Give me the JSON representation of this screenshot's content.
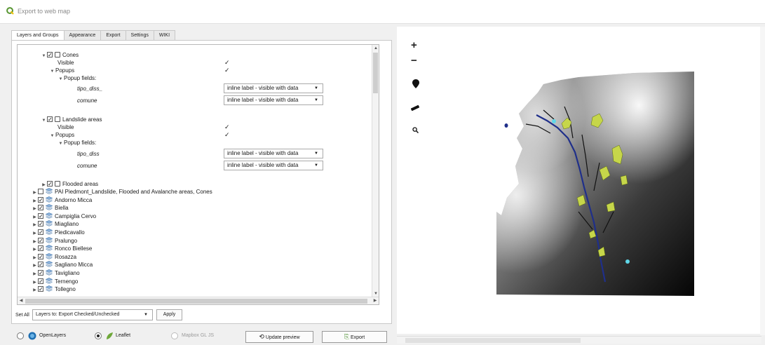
{
  "window": {
    "title": "Export to web map"
  },
  "tabs": [
    "Layers and Groups",
    "Appearance",
    "Export",
    "Settings",
    "WIKI"
  ],
  "tree": {
    "cones": {
      "name": "Cones",
      "visible": "Visible",
      "popups": "Popups",
      "popup_fields": "Popup fields:",
      "fields": [
        {
          "name": "tipo_diss_",
          "value": "inline label - visible with data"
        },
        {
          "name": "comune",
          "value": "inline label - visible with data"
        }
      ]
    },
    "landslide": {
      "name": "Landslide areas",
      "visible": "Visible",
      "popups": "Popups",
      "popup_fields": "Popup fields:",
      "fields": [
        {
          "name": "tipo_diss",
          "value": "inline label - visible with data"
        },
        {
          "name": "comune",
          "value": "inline label - visible with data"
        }
      ]
    },
    "flooded": "Flooded areas",
    "groups": [
      {
        "name": "PAI Piedmont_Landslide, Flooded and Avalanche areas, Cones",
        "checked": false
      },
      {
        "name": "Andorno Micca",
        "checked": true
      },
      {
        "name": "Biella",
        "checked": true
      },
      {
        "name": "Campiglia Cervo",
        "checked": true
      },
      {
        "name": "Miagliano",
        "checked": true
      },
      {
        "name": "Piedicavallo",
        "checked": true
      },
      {
        "name": "Pralungo",
        "checked": true
      },
      {
        "name": "Ronco Biellese",
        "checked": true
      },
      {
        "name": "Rosazza",
        "checked": true
      },
      {
        "name": "Sagliano Micca",
        "checked": true
      },
      {
        "name": "Tavigliano",
        "checked": true
      },
      {
        "name": "Ternengo",
        "checked": true
      },
      {
        "name": "Tollegno",
        "checked": true
      }
    ]
  },
  "set_all": {
    "label": "Set All",
    "value": "Layers to: Export Checked/Unchecked",
    "apply": "Apply"
  },
  "bottom": {
    "openlayers": "OpenLayers",
    "leaflet": "Leaflet",
    "mapbox": "Mapbox GL JS",
    "update_preview": "Update preview",
    "export": "Export",
    "selected": "Leaflet"
  },
  "map": {
    "zoom_in": "+",
    "zoom_out": "−"
  },
  "colors": {
    "accent_green": "#6fa83a",
    "qgis_green": "#589632",
    "raster_light": "#ffffff",
    "raster_dark": "#000000",
    "landslide": "#c6d64a",
    "river": "#1f2f8a",
    "cone": "#5fd7e8"
  }
}
